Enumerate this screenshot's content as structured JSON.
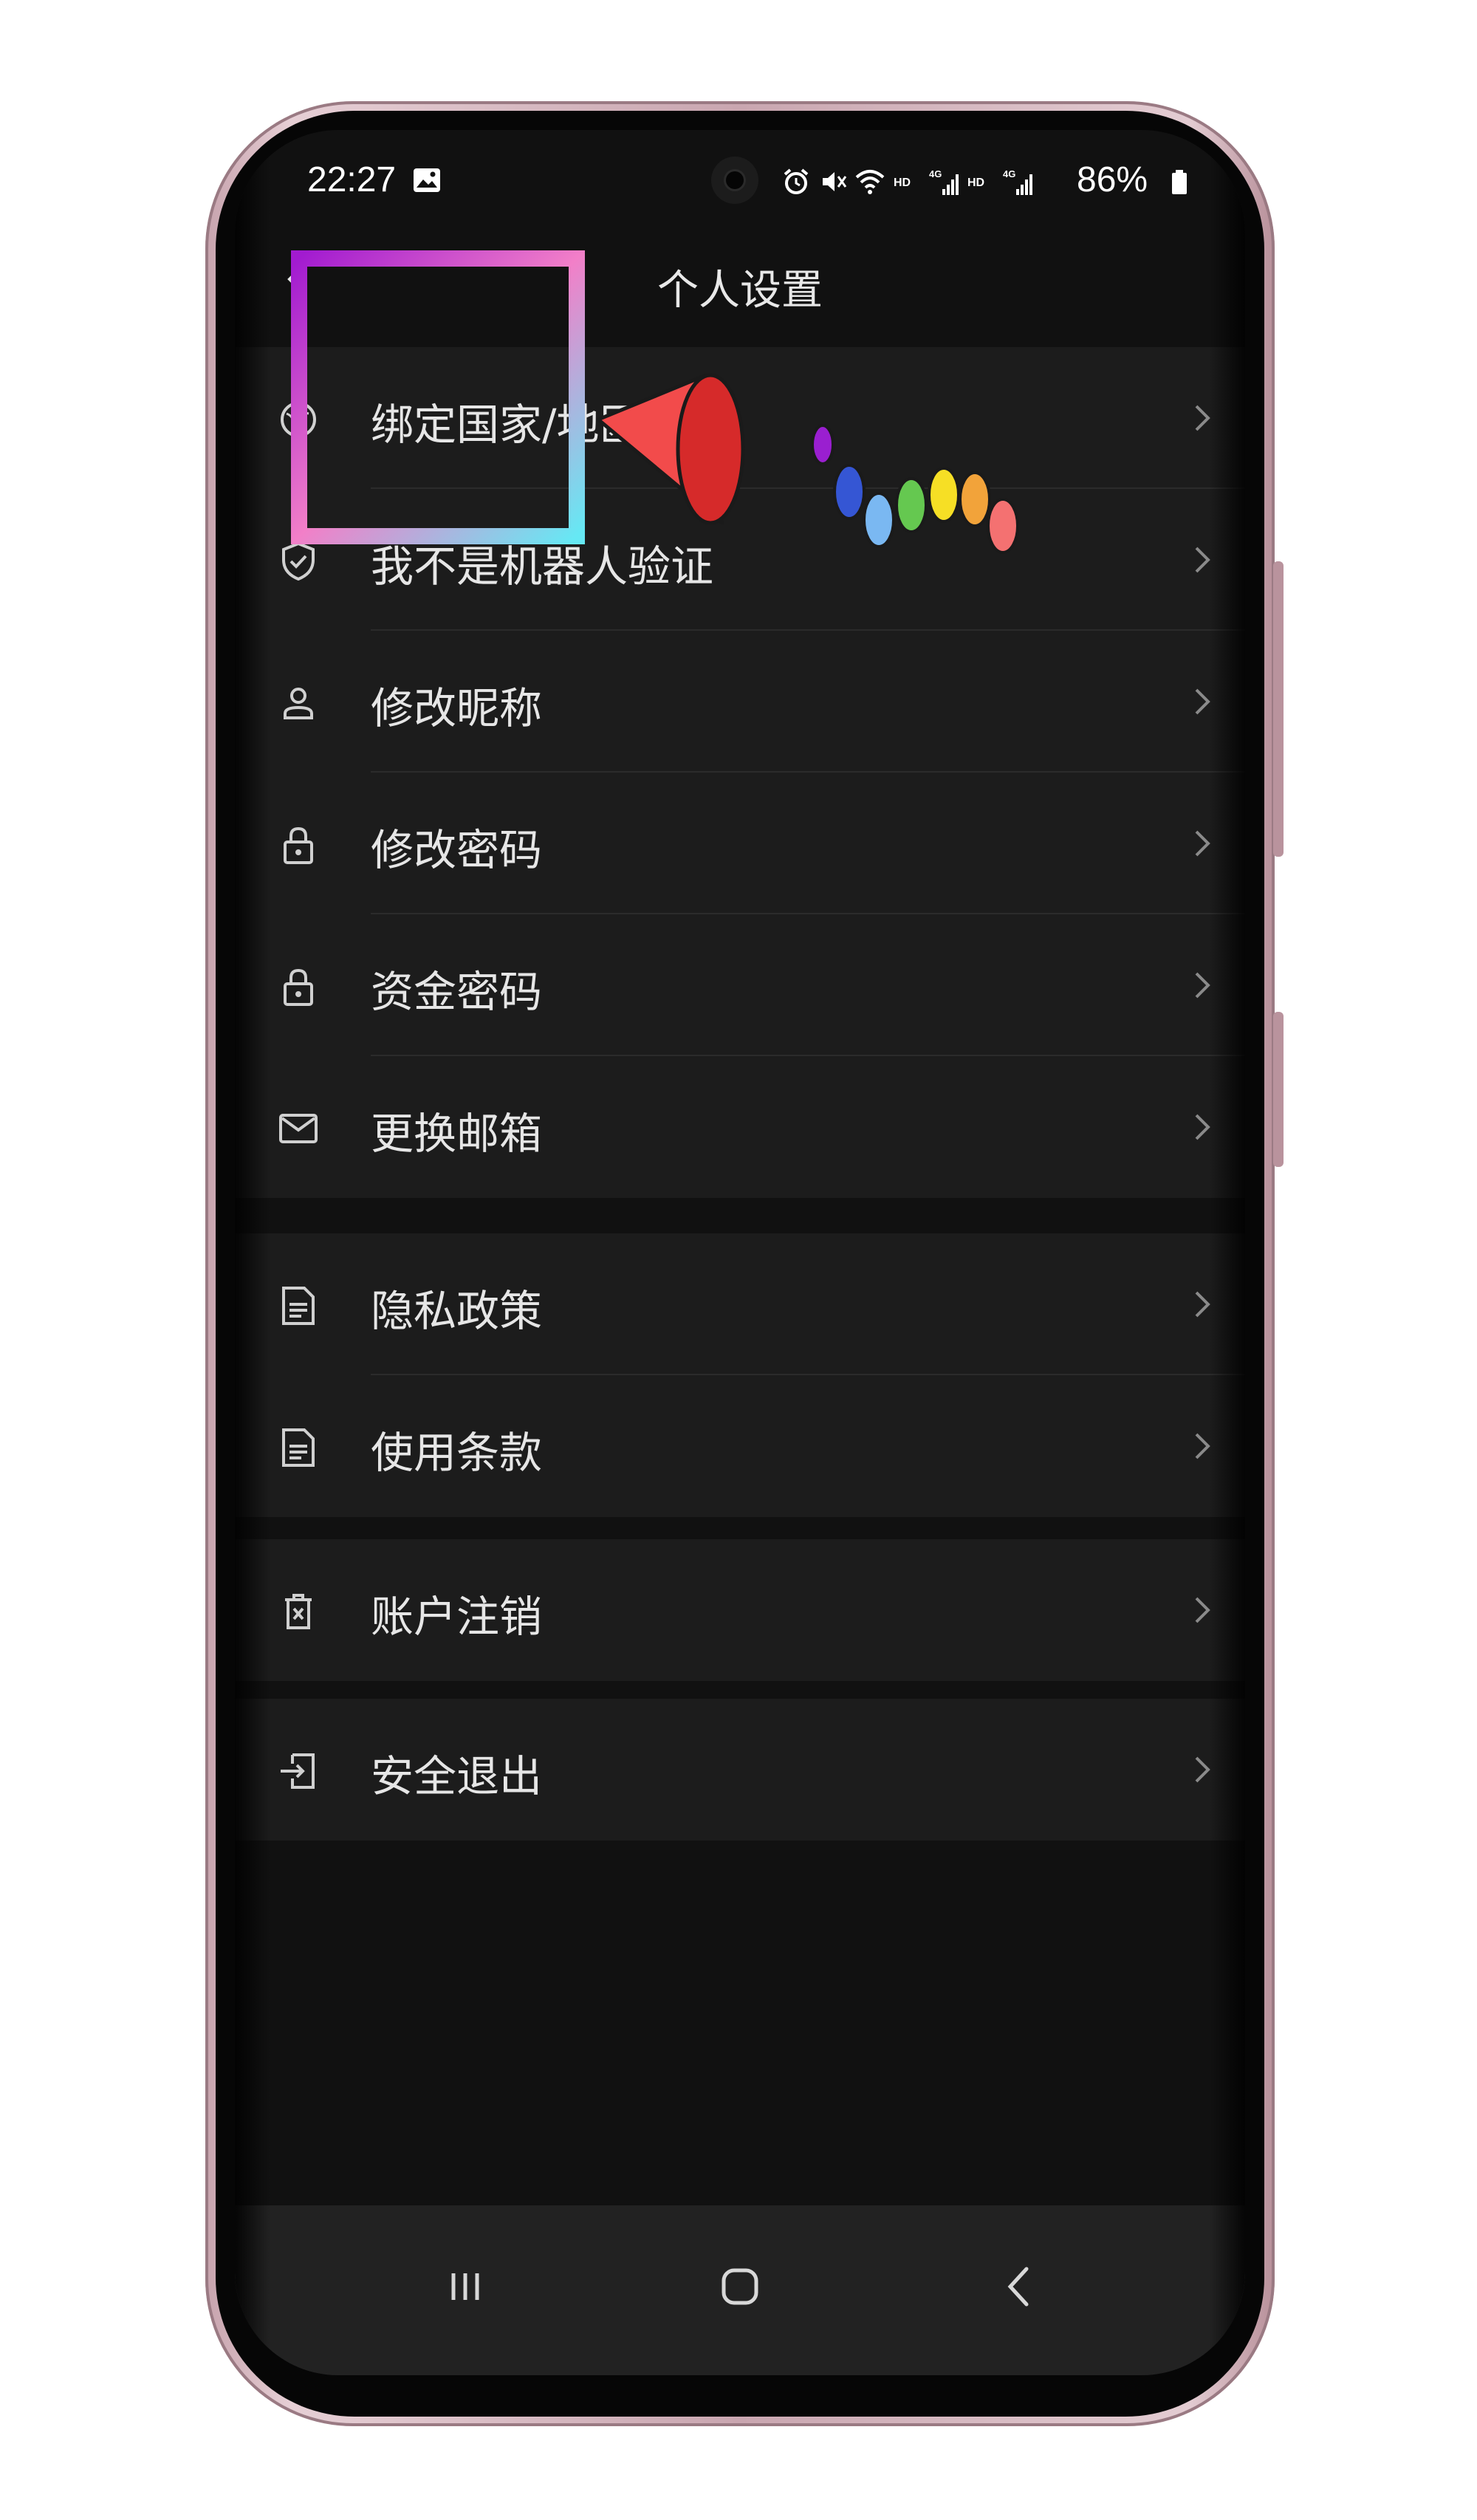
{
  "status_bar": {
    "time": "22:27",
    "battery": "86%",
    "icons": [
      "gallery-icon",
      "alarm-icon",
      "mute-icon",
      "wifi-icon",
      "hd-icon",
      "4g-signal-icon",
      "hd-icon",
      "4g-signal-icon",
      "battery-icon"
    ]
  },
  "header": {
    "title": "个人设置",
    "back_icon": "back-arrow-icon"
  },
  "sections": [
    {
      "items": [
        {
          "label": "绑定国家/地区",
          "icon": "globe-icon"
        },
        {
          "label": "我不是机器人验证",
          "icon": "shield-check-icon"
        },
        {
          "label": "修改昵称",
          "icon": "person-icon"
        },
        {
          "label": "修改密码",
          "icon": "lock-icon"
        },
        {
          "label": "资金密码",
          "icon": "lock-icon"
        },
        {
          "label": "更换邮箱",
          "icon": "mail-icon"
        }
      ]
    },
    {
      "items": [
        {
          "label": "隐私政策",
          "icon": "document-icon"
        },
        {
          "label": "使用条款",
          "icon": "document-icon"
        }
      ]
    },
    {
      "items": [
        {
          "label": "账户注销",
          "icon": "trash-icon"
        }
      ]
    },
    {
      "items": [
        {
          "label": "安全退出",
          "icon": "logout-icon"
        }
      ]
    }
  ],
  "nav_bar": {
    "buttons": [
      "recents-icon",
      "home-icon",
      "back-icon"
    ]
  },
  "colors": {
    "background": "#111111",
    "row_background": "#1c1c1c",
    "text": "#e6e6e6",
    "frame": "#c9a6b0"
  }
}
